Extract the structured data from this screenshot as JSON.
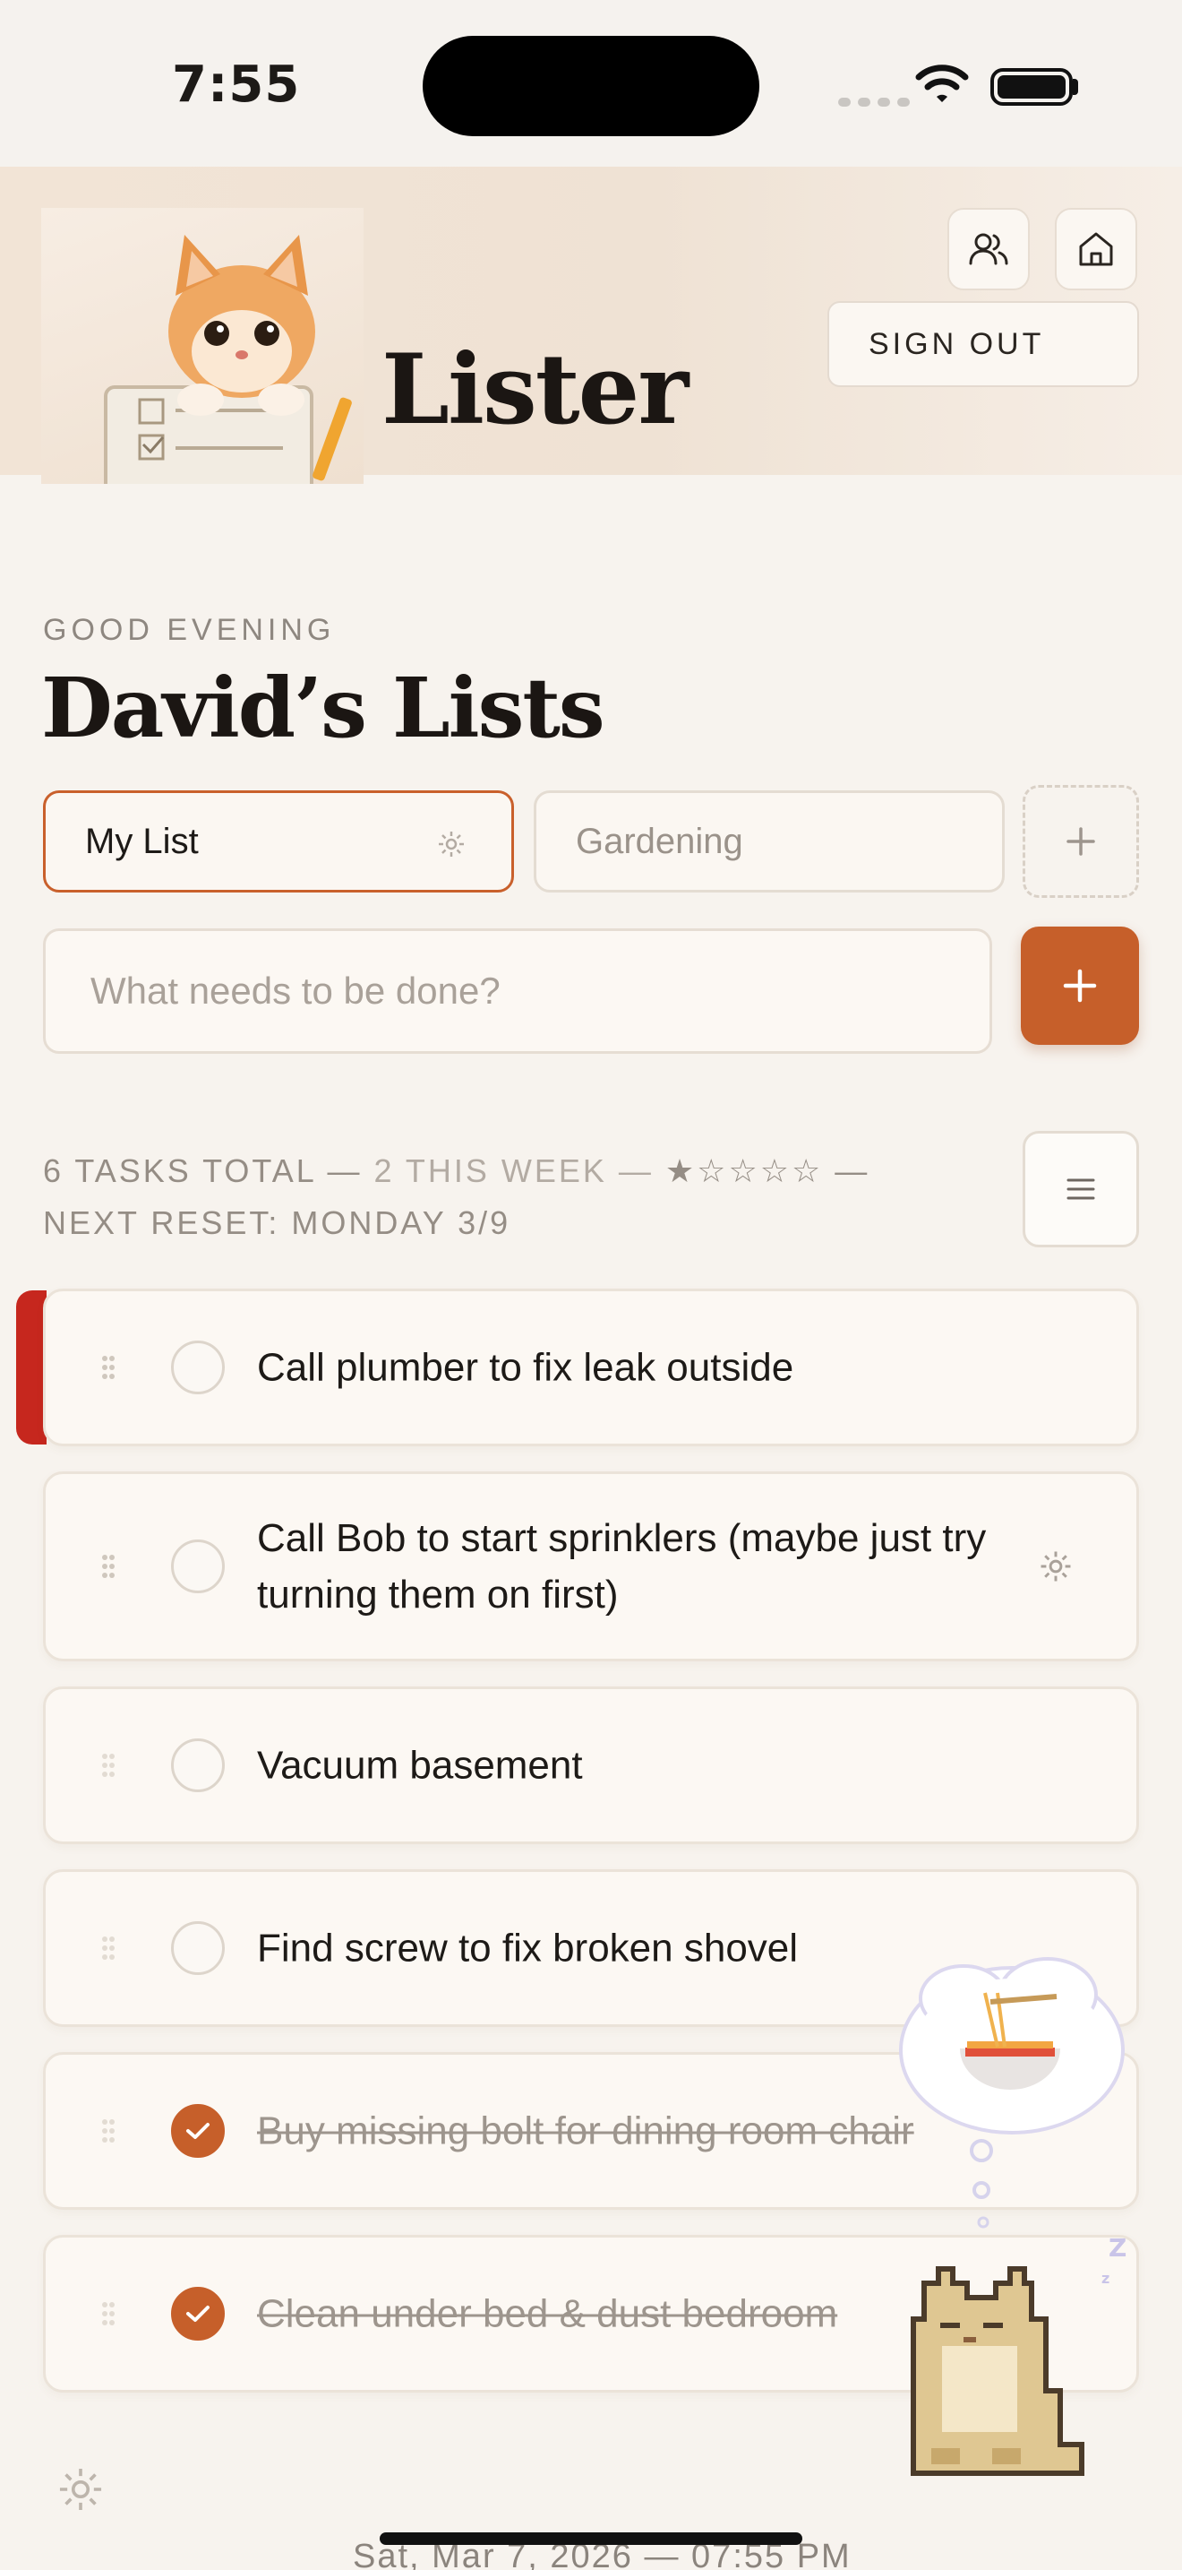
{
  "status_bar": {
    "time": "7:55"
  },
  "header": {
    "app_title": "Lister",
    "sign_out_label": "SIGN OUT"
  },
  "greeting": "GOOD EVENING",
  "page_title": "David’s Lists",
  "lists": [
    {
      "label": "My List",
      "active": true
    },
    {
      "label": "Gardening",
      "active": false
    }
  ],
  "task_input": {
    "placeholder": "What needs to be done?",
    "value": ""
  },
  "stats": {
    "total": "6 TASKS TOTAL —",
    "this_week": "2 THIS WEEK —",
    "stars": "★☆☆☆☆",
    "dash": "—",
    "next_reset": "NEXT RESET: MONDAY 3/9"
  },
  "tasks": [
    {
      "text": "Call plumber to fix leak outside",
      "done": false,
      "flagged": true
    },
    {
      "text": "Call Bob to start sprinklers (maybe just try turning them on first)",
      "done": false
    },
    {
      "text": "Vacuum basement",
      "done": false
    },
    {
      "text": "Find screw to fix broken shovel",
      "done": false
    },
    {
      "text": "Buy missing bolt for dining room chair",
      "done": true
    },
    {
      "text": "Clean under bed & dust bedroom",
      "done": true
    }
  ],
  "footer": {
    "date": "Sat, Mar 7, 2026 — 07:55 PM"
  },
  "colors": {
    "accent": "#c65f2a",
    "flag": "#c6271e",
    "background": "#f7f3ee"
  },
  "icons": [
    "wifi-icon",
    "battery-icon",
    "people-icon",
    "home-icon",
    "gear-icon",
    "plus-icon",
    "menu-icon",
    "drag-handle-icon",
    "check-icon",
    "noodle-bowl-icon",
    "sleeping-cat-icon"
  ]
}
